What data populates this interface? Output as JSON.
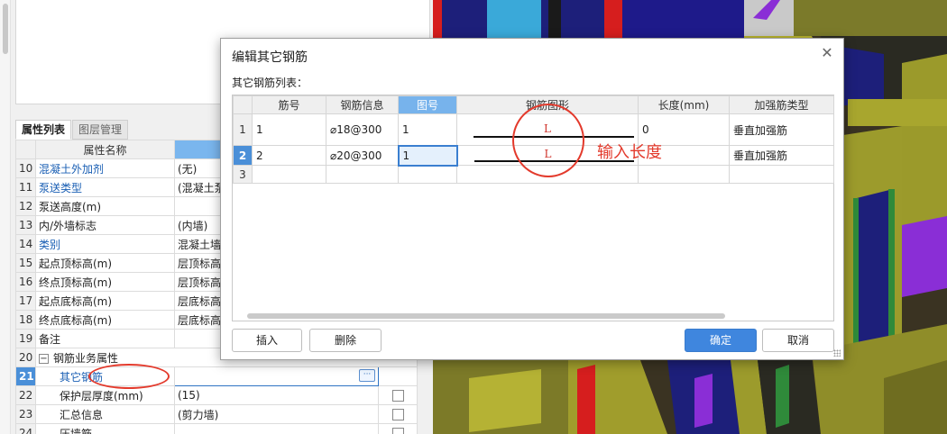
{
  "properties_panel": {
    "tabs": [
      {
        "label": "属性列表",
        "active": true
      },
      {
        "label": "图层管理",
        "active": false
      }
    ],
    "header": {
      "name_col": "属性名称",
      "value_col": ""
    },
    "rows": [
      {
        "num": "10",
        "name": "混凝土外加剂",
        "value": "(无)",
        "blue": true
      },
      {
        "num": "11",
        "name": "泵送类型",
        "value": "(混凝土泵",
        "blue": true
      },
      {
        "num": "12",
        "name": "泵送高度(m)",
        "value": "",
        "blue": false
      },
      {
        "num": "13",
        "name": "内/外墙标志",
        "value": "(内墙)",
        "blue": false
      },
      {
        "num": "14",
        "name": "类别",
        "value": "混凝土墙",
        "blue": true
      },
      {
        "num": "15",
        "name": "起点顶标高(m)",
        "value": "层顶标高",
        "blue": false
      },
      {
        "num": "16",
        "name": "终点顶标高(m)",
        "value": "层顶标高",
        "blue": false
      },
      {
        "num": "17",
        "name": "起点底标高(m)",
        "value": "层底标高",
        "blue": false
      },
      {
        "num": "18",
        "name": "终点底标高(m)",
        "value": "层底标高",
        "blue": false
      },
      {
        "num": "19",
        "name": "备注",
        "value": "",
        "blue": false
      }
    ],
    "group_row": {
      "num": "20",
      "expander": "−",
      "name": "钢筋业务属性"
    },
    "sub_rows": [
      {
        "num": "21",
        "name": "其它钢筋",
        "value": "",
        "blue": true,
        "selected": true,
        "button": "···"
      },
      {
        "num": "22",
        "name": "保护层厚度(mm)",
        "value": "(15)",
        "blue": false
      },
      {
        "num": "23",
        "name": "汇总信息",
        "value": "(剪力墙)",
        "blue": false
      },
      {
        "num": "24",
        "name": "压墙筋",
        "value": "",
        "blue": false
      }
    ]
  },
  "dialog": {
    "title": "编辑其它钢筋",
    "close_icon": "close-icon",
    "list_label": "其它钢筋列表：",
    "columns": [
      "",
      "筋号",
      "钢筋信息",
      "图号",
      "钢筋图形",
      "长度(mm)",
      "加强筋类型"
    ],
    "rows": [
      {
        "row_num": "1",
        "bar_no": "1",
        "rebar_info": "⌀18@300",
        "figure_no": "1",
        "shape_label": "L",
        "length": "0",
        "type": "垂直加强筋"
      },
      {
        "row_num": "2",
        "bar_no": "2",
        "rebar_info": "⌀20@300",
        "figure_no": "1",
        "shape_label": "L",
        "length": "",
        "type": "垂直加强筋"
      },
      {
        "row_num": "3",
        "bar_no": "",
        "rebar_info": "",
        "figure_no": "",
        "shape_label": "",
        "length": "",
        "type": ""
      }
    ],
    "buttons": {
      "insert": "插入",
      "delete": "删除",
      "ok": "确定",
      "cancel": "取消"
    }
  },
  "annotation": {
    "text": "输入长度",
    "color": "#e33a2c"
  },
  "colors": {
    "accent": "#3f86de",
    "selected_row": "#4a8fd8",
    "active_header": "#77b3ec",
    "annotation_red": "#e33a2c"
  }
}
